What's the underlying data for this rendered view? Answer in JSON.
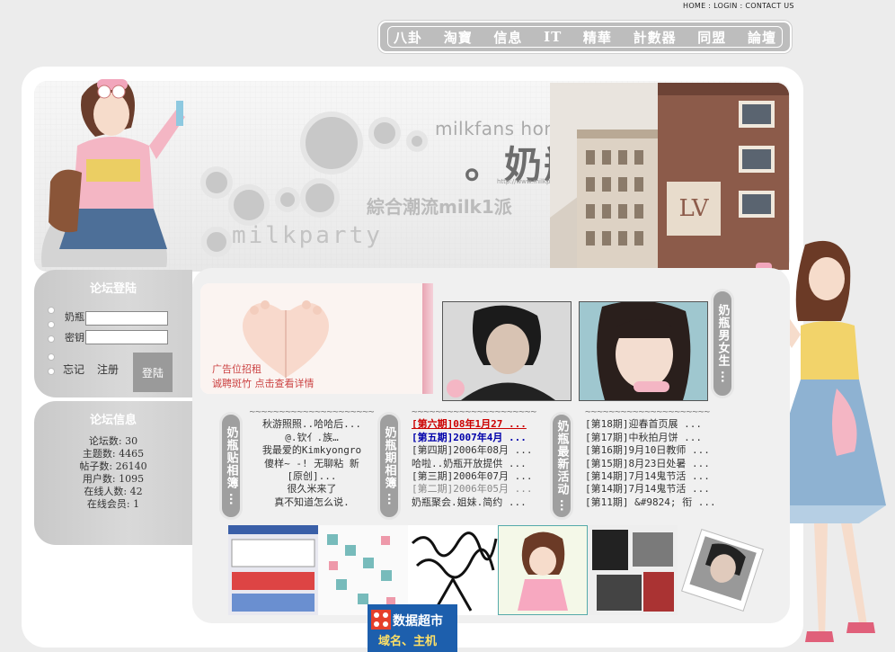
{
  "top_links": "HOME : LOGIN : CONTACT US",
  "nav": [
    "八卦",
    "淘寶",
    "信息",
    "IT",
    "精華",
    "計數器",
    "同盟",
    "論壇"
  ],
  "banner": {
    "milkfans": "milkfans home",
    "brand": "。奶瓶聚會。",
    "url": "http://www.milkparty.net",
    "slogan": "綜合潮流milk1派",
    "milkparty": "milkparty"
  },
  "login": {
    "title": "论坛登陆",
    "user_label": "奶瓶",
    "pass_label": "密钥",
    "forgot": "忘记",
    "register": "注册",
    "submit": "登陆"
  },
  "info": {
    "title": "论坛信息",
    "stats": [
      "论坛数: 30",
      "主题数: 4465",
      "帖子数: 26140",
      "用户数: 1095",
      "在线人数: 42",
      "在线会员: 1"
    ]
  },
  "ad": {
    "line1": "广告位招租",
    "line2": "诚聘斑竹 点击查看详情"
  },
  "sections": {
    "boys_girls": "奶瓶男女生",
    "post_album": "奶瓶贴相簿",
    "issue_album": "奶瓶期相簿",
    "new_events": "奶瓶最新活动",
    "dots": "···"
  },
  "post_list": {
    "sep": "~~~~~~~~~~~~~~~~~~~~~",
    "items": [
      "秋游照照..哈哈后...",
      "@.钦亻.族…",
      "我最爱的Kimkyongro",
      "傻样~ -! 无聊粘 新",
      "[原创]...",
      "很久米来了",
      "真不知道怎么说."
    ]
  },
  "issue_list": {
    "sep": "~~~~~~~~~~~~~~~~~~~~~",
    "items": [
      "[第六期]08年1月27 ...",
      "[第五期]2007年4月 ...",
      "[第四期]2006年08月 ...",
      "哈啦..奶瓶开放提供 ...",
      "[第三期]2006年07月 ...",
      "[第二期]2006年05月 ...",
      "奶瓶聚会.姐妹.简约 ..."
    ]
  },
  "event_list": {
    "sep": "~~~~~~~~~~~~~~~~~~~~~",
    "items": [
      "[第18期]迎春首页展 ...",
      "[第17期]中秋拍月饼 ...",
      "[第16期]9月10日教师 ...",
      "[第15期]8月23日处暑 ...",
      "[第14期]7月14鬼节活 ...",
      "[第14期]7月14鬼节活 ...",
      "[第11期] &#9824; 衔 ..."
    ]
  },
  "bottom_ad": {
    "title": "数据超市",
    "sub": "域名、主机"
  },
  "colors": {
    "accent_red": "#cc0000",
    "accent_blue": "#0000aa",
    "panel_gray": "#9f9f9f",
    "pink": "#e9a5b3"
  }
}
